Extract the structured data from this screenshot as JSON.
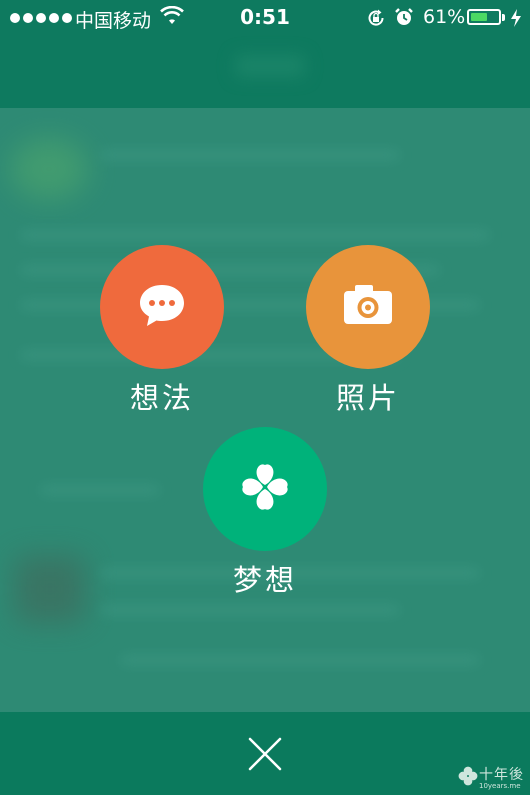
{
  "status_bar": {
    "carrier": "中国移动",
    "time": "0:51",
    "battery_percent": "61%",
    "battery_level": 0.61
  },
  "actions": [
    {
      "label": "想法",
      "icon": "speech-bubble-icon",
      "color": "#ef6a3d"
    },
    {
      "label": "照片",
      "icon": "camera-icon",
      "color": "#e8943b"
    },
    {
      "label": "梦想",
      "icon": "clover-icon",
      "color": "#00b27a"
    }
  ],
  "bottom_bar": {
    "close_icon": "close-icon"
  },
  "watermark": {
    "text": "十年後",
    "sub": "10years.me"
  },
  "colors": {
    "overlay": "#2e8a74",
    "header": "#0e7a5f",
    "bottom_bar": "#0b7a5d"
  }
}
